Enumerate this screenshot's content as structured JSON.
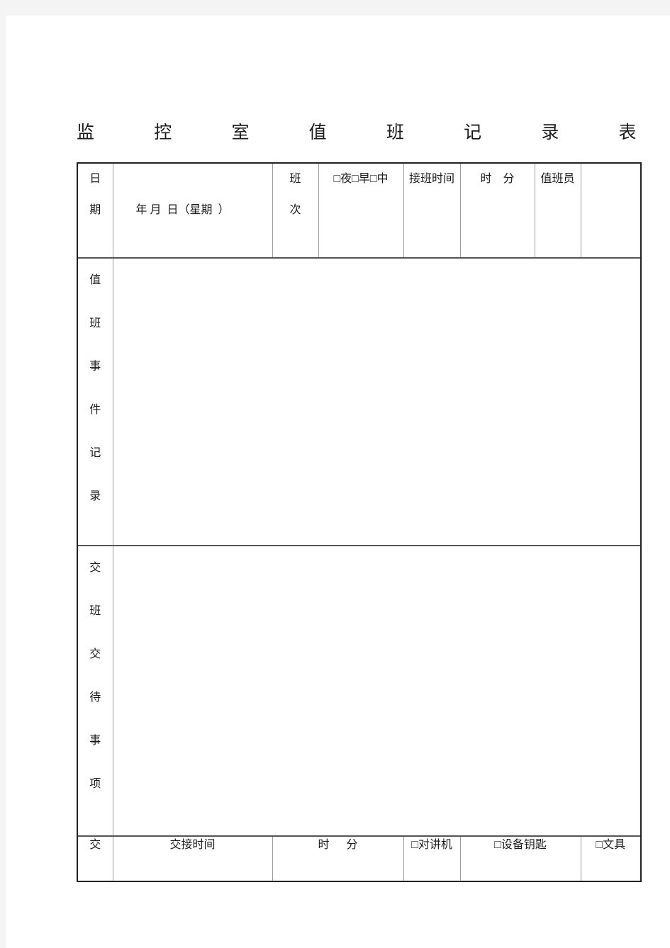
{
  "document": {
    "title_chars": [
      "监",
      "控",
      "室",
      "值",
      "班",
      "记",
      "录",
      "表"
    ],
    "title_text": "监控室值班记录表"
  },
  "table": {
    "header_row": {
      "date_label": "日\n期",
      "date_value": "年 月  日（星期  ）",
      "shift_label": "班\n次",
      "shift_options": "□夜□早□中",
      "handover_label": "接班时间",
      "time_value": "时    分",
      "officer_label": "值班员",
      "officer_value": ""
    },
    "event_row": {
      "label_chars": [
        "值",
        "班",
        "事",
        "件",
        "记",
        "录"
      ],
      "label_text": "值班事件记录",
      "content": ""
    },
    "handover_notes_row": {
      "label_chars": [
        "交",
        "班",
        "交",
        "待",
        "事",
        "项"
      ],
      "label_text": "交班交待事项",
      "content": ""
    },
    "footer_row": {
      "lead_label": "交",
      "time_label": "交接时间",
      "time_value": "时      分",
      "item_radio": "□对讲机",
      "item_keys": "□设备钥匙",
      "item_stationery": "□文具"
    }
  },
  "colors": {
    "page_background": "#f4f4f4",
    "sheet": "#ffffff",
    "text": "#1b1b1b",
    "grid_line": "#9c9c9c",
    "frame_line": "#222222"
  }
}
